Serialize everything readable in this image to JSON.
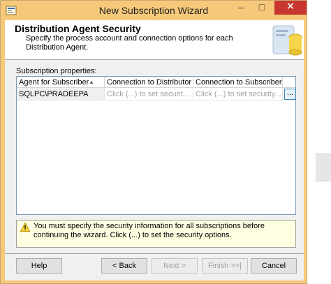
{
  "window": {
    "title": "New Subscription Wizard",
    "minimize": "–",
    "maximize": "□",
    "close": "✕"
  },
  "header": {
    "title": "Distribution Agent Security",
    "description": "Specify the process account and connection options for each Distribution Agent."
  },
  "grid": {
    "label": "Subscription properties:",
    "columns": [
      "Agent for Subscriber",
      "Connection to Distributor",
      "Connection to Subscriber",
      ""
    ],
    "rows": [
      {
        "agent": "SQLPC\\PRADEEPA",
        "distributor": "Click (...) to set securit...",
        "subscriber": "Click (...) to set security...",
        "button": "..."
      }
    ]
  },
  "warning": {
    "text": "You must specify the security information for all subscriptions before continuing the wizard. Click (...) to set the security options."
  },
  "buttons": {
    "help": "Help",
    "back": "< Back",
    "next": "Next >",
    "finish": "Finish >>|",
    "cancel": "Cancel"
  },
  "colors": {
    "title_bar": "#f6c97a",
    "close_button": "#c7372f",
    "warning_bg": "#ffffe1"
  }
}
